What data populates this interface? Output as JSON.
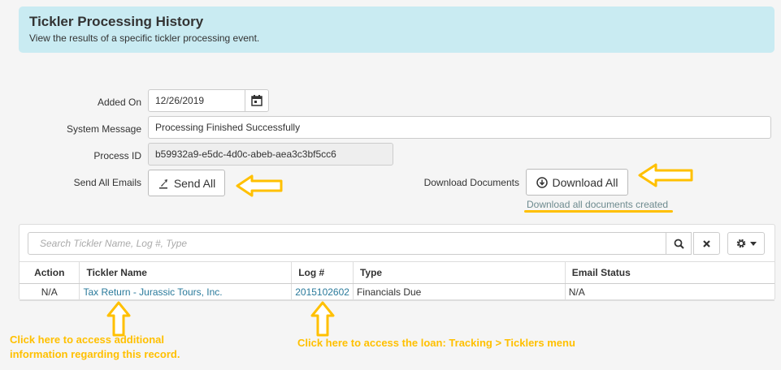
{
  "header": {
    "title": "Tickler Processing History",
    "subtitle": "View the results of a specific tickler processing event."
  },
  "form": {
    "added_on_label": "Added On",
    "added_on_value": "12/26/2019",
    "system_message_label": "System Message",
    "system_message_value": "Processing Finished Successfully",
    "process_id_label": "Process ID",
    "process_id_value": "b59932a9-e5dc-4d0c-abeb-aea3c3bf5cc6",
    "send_all_emails_label": "Send All Emails",
    "send_all_button": "Send All",
    "download_documents_label": "Download Documents",
    "download_all_button": "Download All",
    "download_note": "Download all documents created"
  },
  "grid": {
    "search_placeholder": "Search Tickler Name, Log #, Type",
    "columns": [
      "Action",
      "Tickler Name",
      "Log #",
      "Type",
      "Email Status"
    ],
    "rows": [
      {
        "action": "N/A",
        "tickler_name": "Tax Return - Jurassic Tours, Inc.",
        "log": "2015102602",
        "type": "Financials Due",
        "email_status": "N/A"
      }
    ]
  },
  "annotations": {
    "left_line1": "Click here to access additional",
    "left_line2": "information regarding this record.",
    "middle": "Click here to access the loan: Tracking > Ticklers menu"
  },
  "colors": {
    "header_bg": "#c9ebf2",
    "annotation": "#ffc000",
    "link": "#2a7a9b"
  }
}
